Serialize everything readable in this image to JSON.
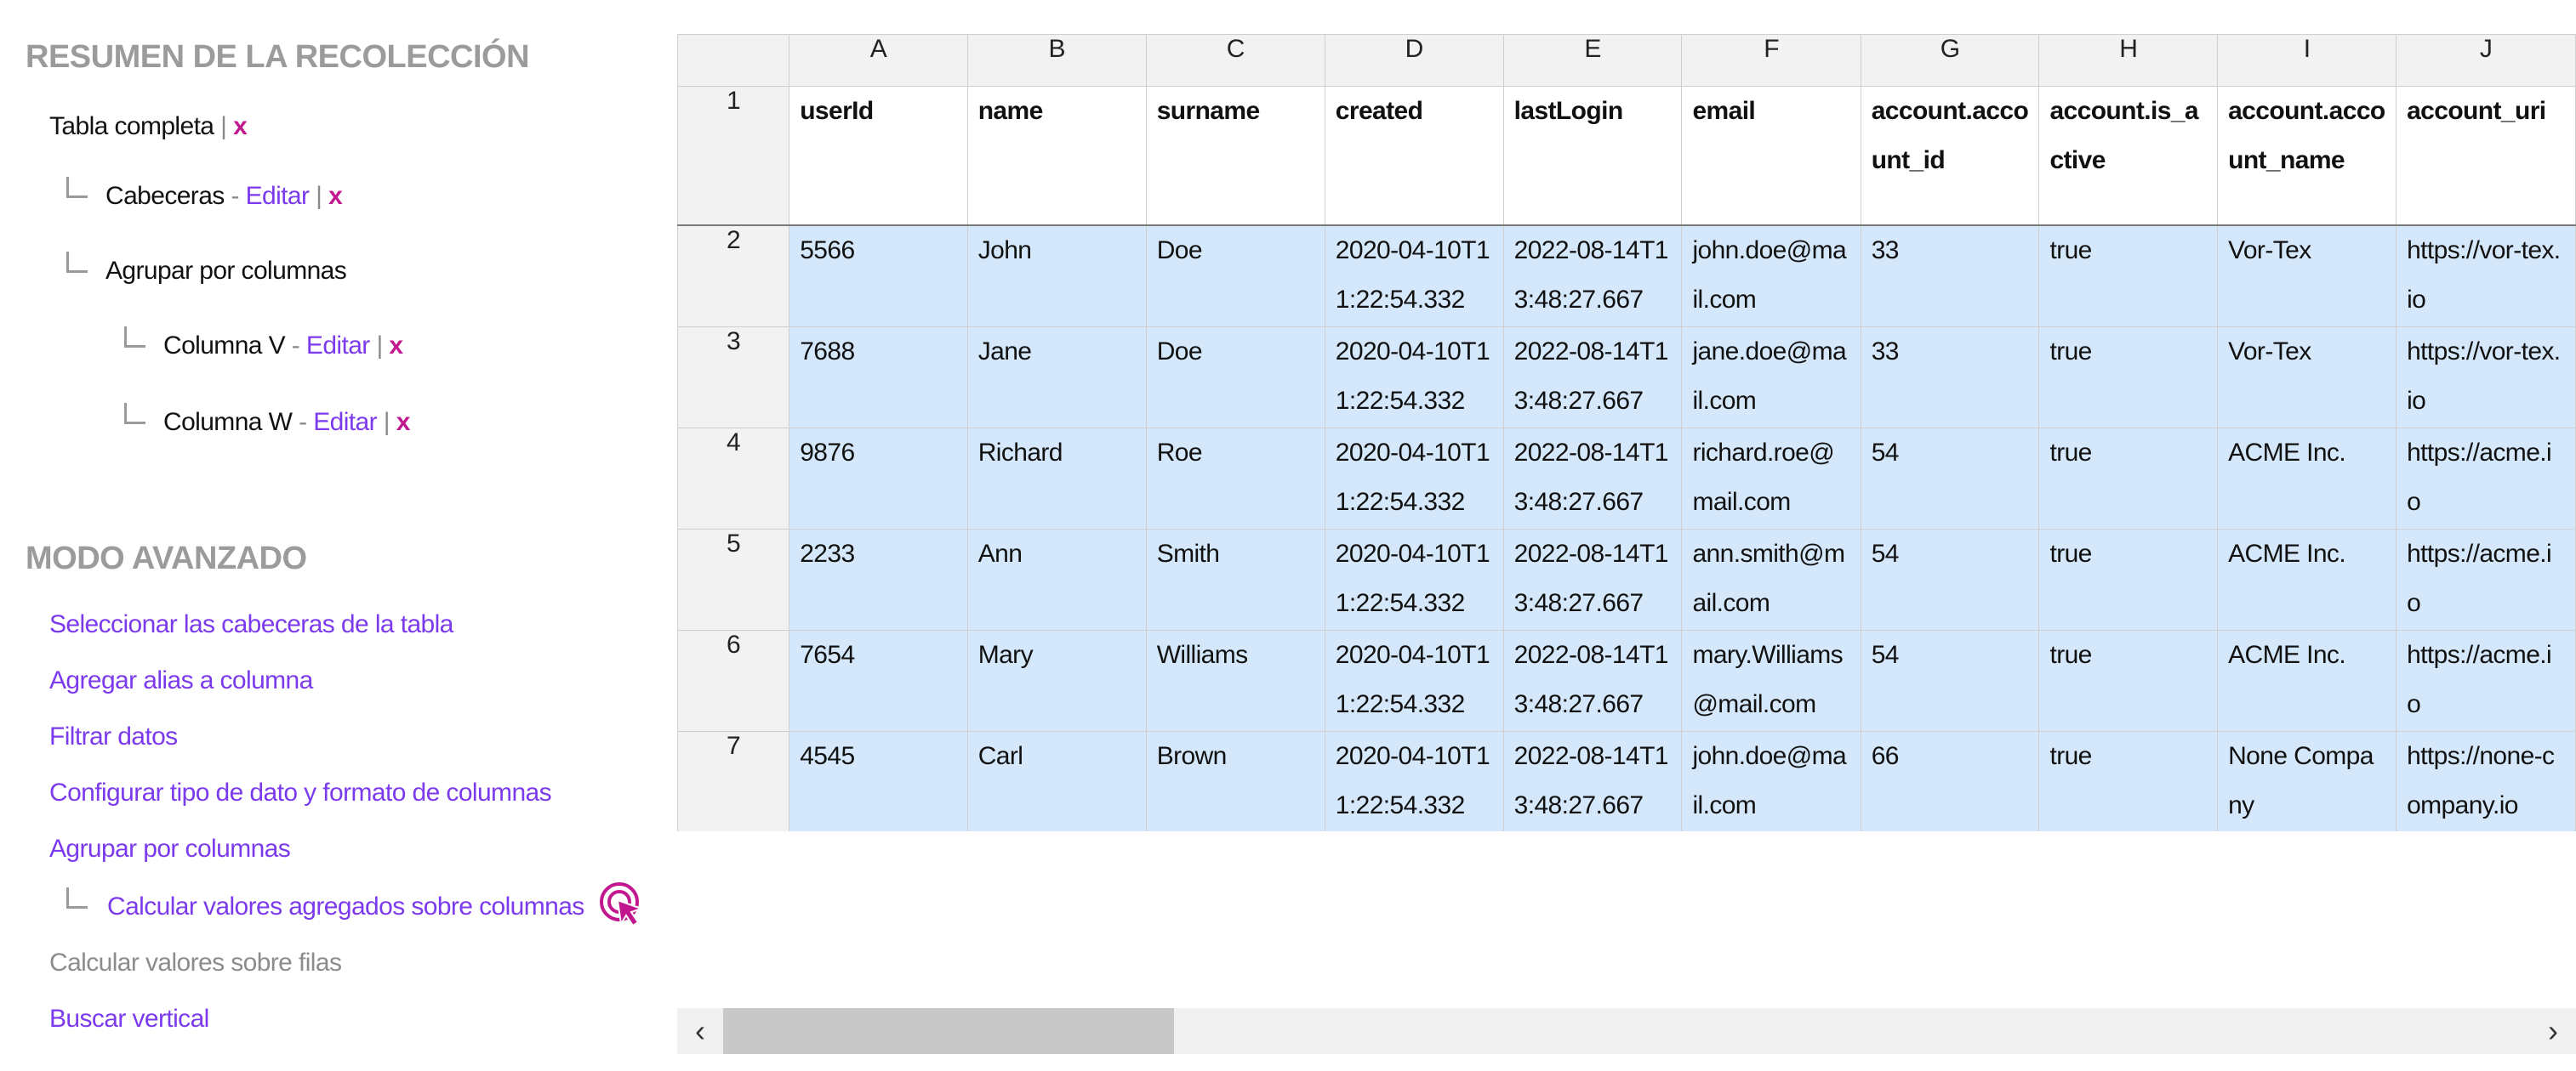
{
  "summary": {
    "title": "RESUMEN DE LA RECOLECCIÓN",
    "tree": {
      "full_table": "Tabla completa",
      "headers": "Cabeceras",
      "group_by": "Agrupar por columnas",
      "column_v": "Columna V",
      "column_w": "Columna W",
      "edit": "Editar",
      "remove": "x",
      "pipe": "|",
      "dash": "-"
    }
  },
  "advanced": {
    "title": "MODO AVANZADO",
    "links": [
      "Seleccionar las cabeceras de la tabla",
      "Agregar alias a columna",
      "Filtrar datos",
      "Configurar tipo de dato y formato de columnas",
      "Agrupar por columnas",
      "Calcular valores agregados sobre columnas",
      "Calcular valores sobre filas",
      "Buscar vertical"
    ]
  },
  "sheet": {
    "columns": [
      "A",
      "B",
      "C",
      "D",
      "E",
      "F",
      "G",
      "H",
      "I",
      "J"
    ],
    "row_numbers": [
      "1",
      "2",
      "3",
      "4",
      "5",
      "6",
      "7"
    ],
    "headers": [
      "userId",
      "name",
      "surname",
      "created",
      "lastLogin",
      "email",
      "account.account_id",
      "account.is_active",
      "account.account_name",
      "account_uri"
    ],
    "rows": [
      [
        "5566",
        "John",
        "Doe",
        "2020-04-10T11:22:54.332",
        "2022-08-14T13:48:27.667",
        "john.doe@mail.com",
        "33",
        "true",
        "Vor-Tex",
        "https://vor-tex.io"
      ],
      [
        "7688",
        "Jane",
        "Doe",
        "2020-04-10T11:22:54.332",
        "2022-08-14T13:48:27.667",
        "jane.doe@mail.com",
        "33",
        "true",
        "Vor-Tex",
        "https://vor-tex.io"
      ],
      [
        "9876",
        "Richard",
        "Roe",
        "2020-04-10T11:22:54.332",
        "2022-08-14T13:48:27.667",
        "richard.roe@mail.com",
        "54",
        "true",
        "ACME Inc.",
        "https://acme.io"
      ],
      [
        "2233",
        "Ann",
        "Smith",
        "2020-04-10T11:22:54.332",
        "2022-08-14T13:48:27.667",
        "ann.smith@mail.com",
        "54",
        "true",
        "ACME Inc.",
        "https://acme.io"
      ],
      [
        "7654",
        "Mary",
        "Williams",
        "2020-04-10T11:22:54.332",
        "2022-08-14T13:48:27.667",
        "mary.Williams@mail.com",
        "54",
        "true",
        "ACME Inc.",
        "https://acme.io"
      ],
      [
        "4545",
        "Carl",
        "Brown",
        "2020-04-10T11:22:54.332",
        "2022-08-14T13:48:27.667",
        "john.doe@mail.com",
        "66",
        "true",
        "None Company",
        "https://none-company.io"
      ]
    ]
  },
  "scrollbar": {
    "left_arrow": "‹",
    "right_arrow": "›"
  },
  "colors": {
    "accent": "#7c3aed",
    "remove": "#c2188f",
    "selection": "#d5e8fb"
  }
}
